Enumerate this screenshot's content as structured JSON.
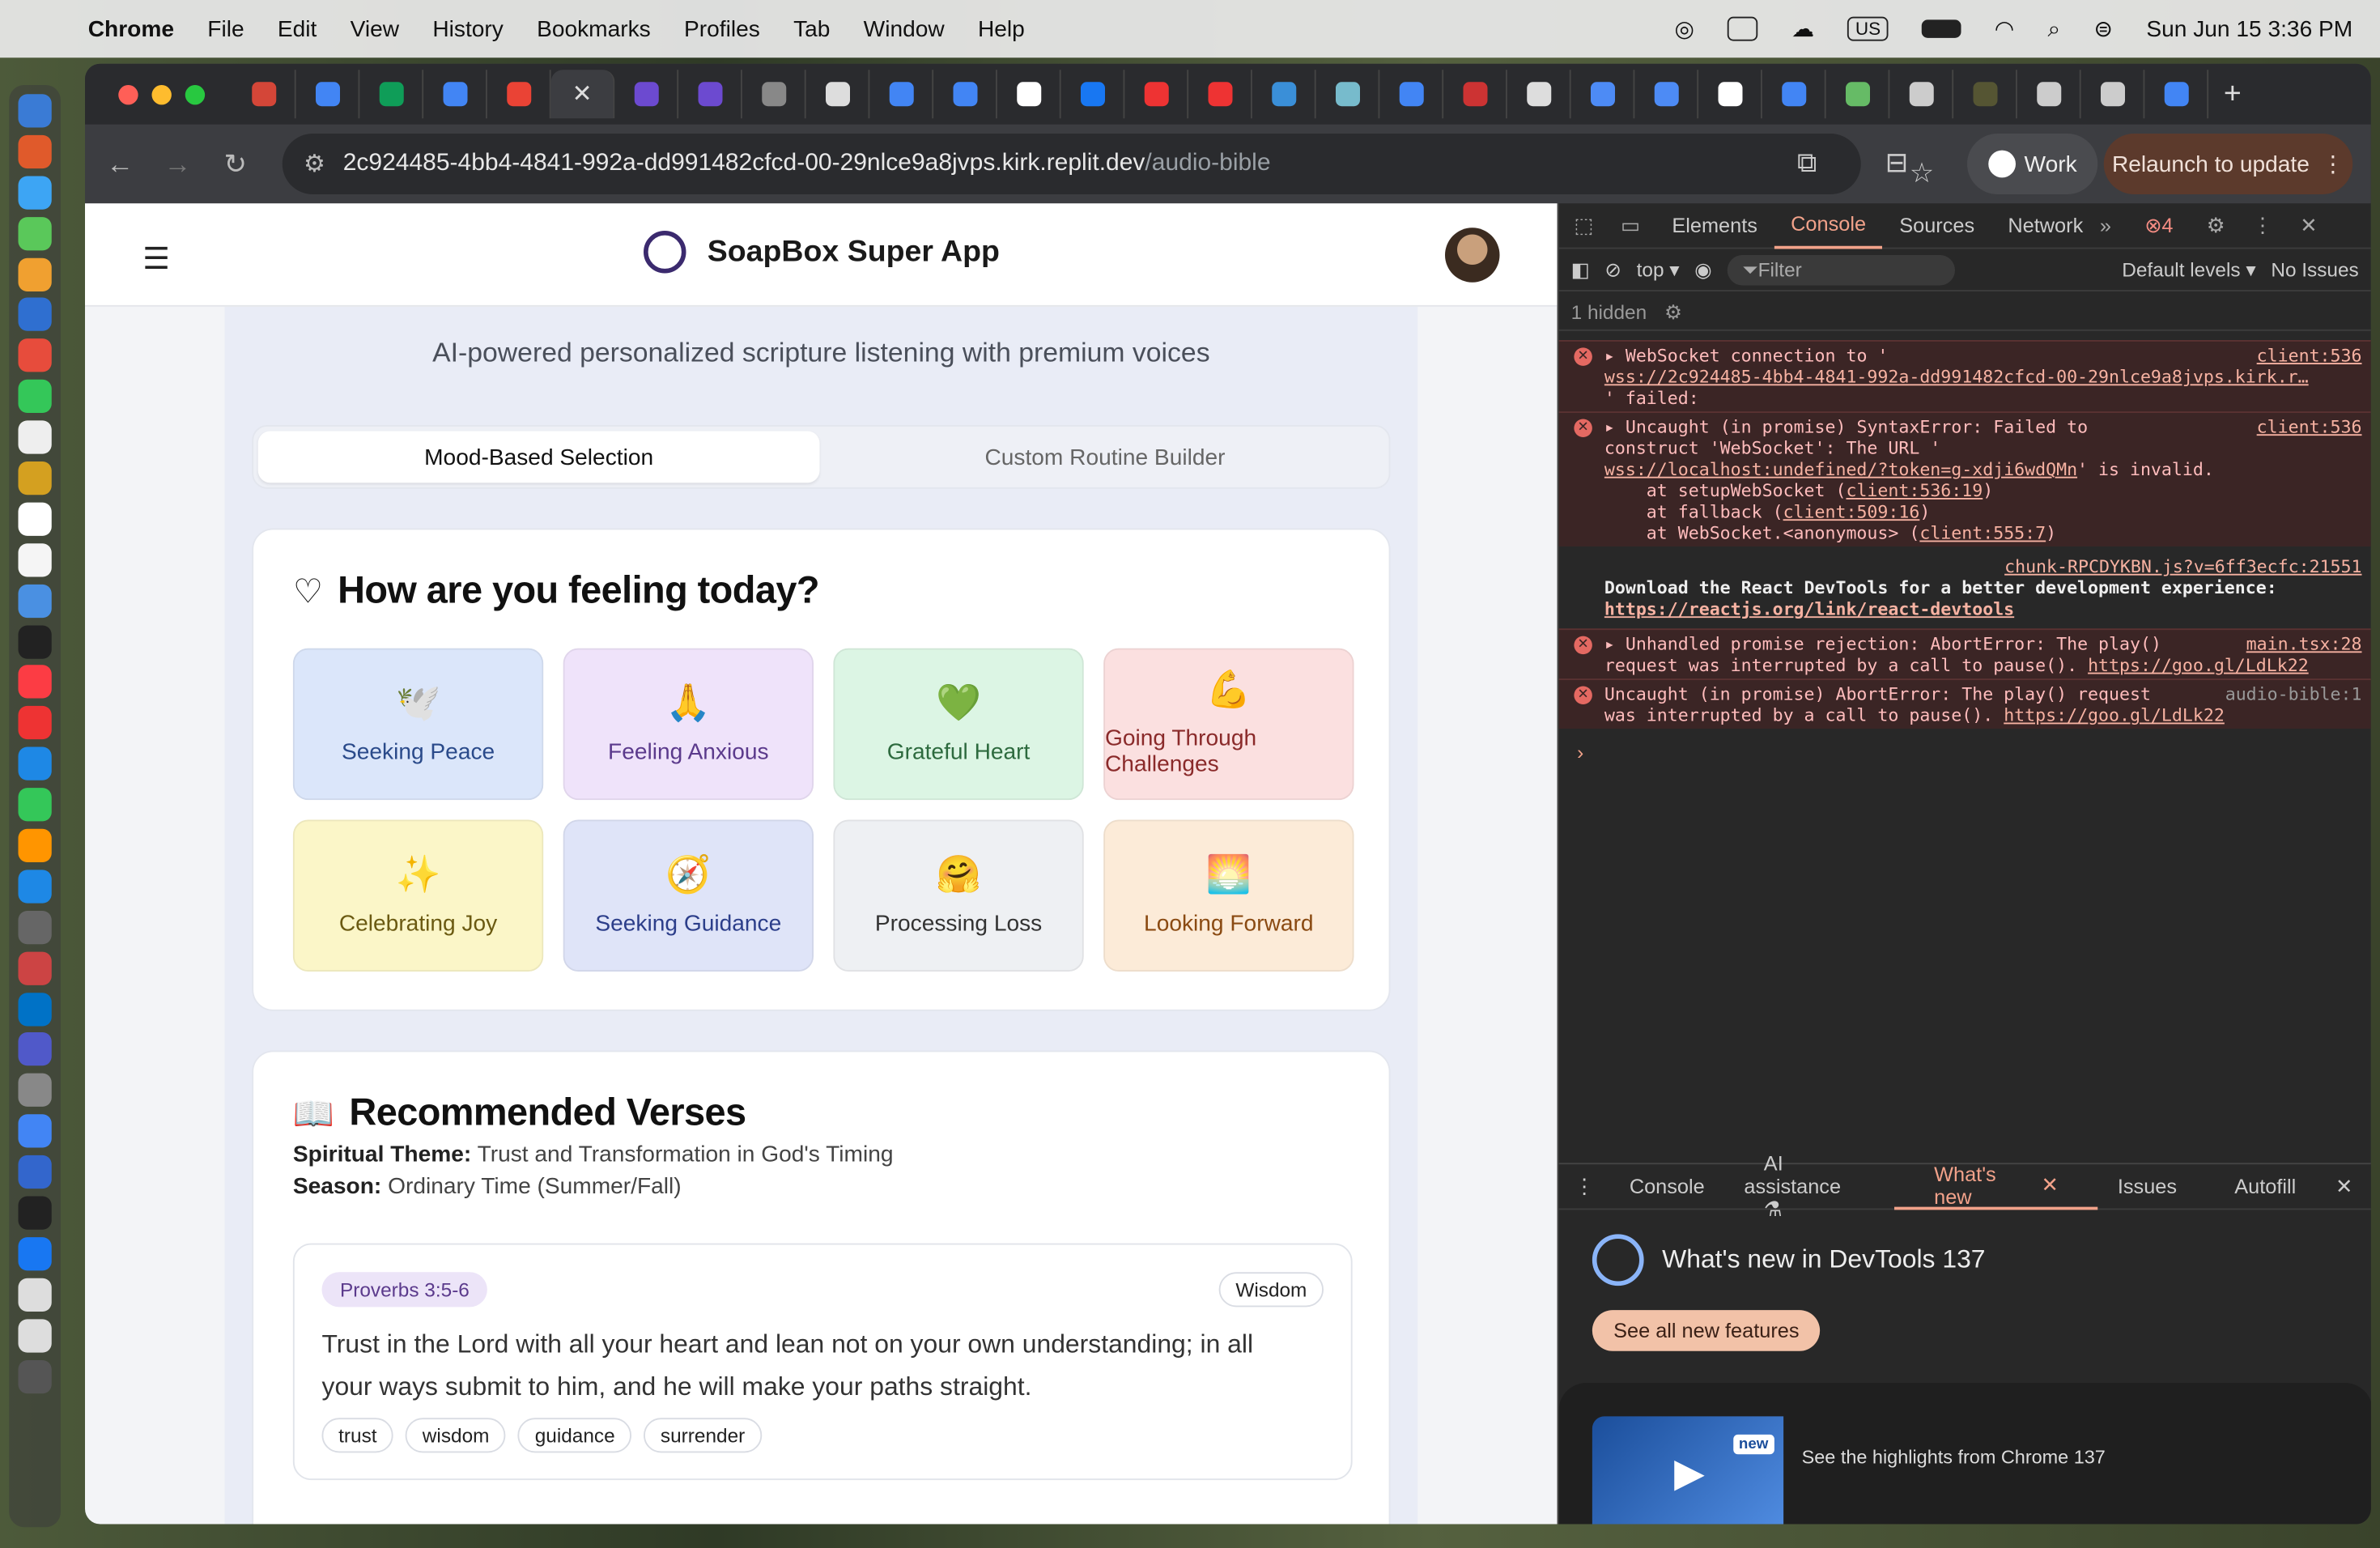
{
  "menubar": {
    "app": "Chrome",
    "items": [
      "File",
      "Edit",
      "View",
      "History",
      "Bookmarks",
      "Profiles",
      "Tab",
      "Window",
      "Help"
    ],
    "datetime": "Sun Jun 15  3:36 PM",
    "us_badge": "US"
  },
  "browser": {
    "url_host": "2c924485-4bb4-4841-992a-dd991482cfcd-00-29nlce9a8jvps.kirk.replit.dev",
    "url_path": "/audio-bible",
    "profile": "Work",
    "relaunch": "Relaunch to update",
    "tab_favicons": [
      "#d44638",
      "#4285f4",
      "#0f9d58",
      "#4285f4",
      "#ea4335",
      "close",
      "#6c4ad0",
      "#6c4ad0",
      "#888",
      "#ddd",
      "#4285f4",
      "#4285f4",
      "#fff",
      "#1877f2",
      "#e33",
      "#e33",
      "#3a8fd8",
      "#7bc",
      "#4285f4",
      "#c33",
      "#ddd",
      "#4d8bf5",
      "#4d8bf5",
      "#fff",
      "#4285f4",
      "#6b6",
      "#ccc",
      "#553",
      "#ccc",
      "#ccc",
      "#4285f4"
    ]
  },
  "app": {
    "title": "SoapBox Super App",
    "subtitle": "AI-powered personalized scripture listening with premium voices",
    "tabs": {
      "mood": "Mood-Based Selection",
      "routine": "Custom Routine Builder"
    },
    "mood_heading": "How are you feeling today?",
    "moods": [
      {
        "emoji": "🕊️",
        "label": "Seeking Peace",
        "bg": "#dbe6fa",
        "fg": "#2a4a8a"
      },
      {
        "emoji": "🙏",
        "label": "Feeling Anxious",
        "bg": "#efe3fa",
        "fg": "#5b3a8c"
      },
      {
        "emoji": "💚",
        "label": "Grateful Heart",
        "bg": "#dcf5e4",
        "fg": "#2d6a3e"
      },
      {
        "emoji": "💪",
        "label": "Going Through Challenges",
        "bg": "#fbe0e0",
        "fg": "#8a2a2a"
      },
      {
        "emoji": "✨",
        "label": "Celebrating Joy",
        "bg": "#fbf6c8",
        "fg": "#6b5a12"
      },
      {
        "emoji": "🧭",
        "label": "Seeking Guidance",
        "bg": "#dfe4f8",
        "fg": "#2c3e8a"
      },
      {
        "emoji": "🤗",
        "label": "Processing Loss",
        "bg": "#eef0f3",
        "fg": "#333"
      },
      {
        "emoji": "🌅",
        "label": "Looking Forward",
        "bg": "#fcebd8",
        "fg": "#8a4a12"
      }
    ],
    "verses_heading": "Recommended Verses",
    "theme_label": "Spiritual Theme:",
    "theme": "Trust and Transformation in God's Timing",
    "season_label": "Season:",
    "season": "Ordinary Time (Summer/Fall)",
    "verse": {
      "ref": "Proverbs 3:5-6",
      "category": "Wisdom",
      "text": "Trust in the Lord with all your heart and lean not on your own understanding; in all your ways submit to him, and he will make your paths straight.",
      "tags": [
        "trust",
        "wisdom",
        "guidance",
        "surrender"
      ]
    }
  },
  "devtools": {
    "tabs": [
      "Elements",
      "Console",
      "Sources",
      "Network"
    ],
    "error_count": "4",
    "context": "top",
    "filter_placeholder": "Filter",
    "levels": "Default levels",
    "issues": "No Issues",
    "hidden": "1 hidden",
    "logs": {
      "e1a": "WebSocket connection to '",
      "e1b": "wss://2c924485-4bb4-4841-992a-dd991482cfcd-00-29nlce9a8jvps.kirk.r…",
      "e1c": "' failed:",
      "e1src": "client:536",
      "e2a": "Uncaught (in promise) SyntaxError: Failed to",
      "e2b": "construct 'WebSocket': The URL '",
      "e2c": "wss://localhost:undefined/?token=g-xdji6wdQMn",
      "e2d": "' is invalid.",
      "e2e": "    at setupWebSocket (",
      "e2f": "client:536:19",
      "e2g": "    at fallback (",
      "e2h": "client:509:16",
      "e2i": "    at WebSocket.<anonymous> (",
      "e2j": "client:555:7",
      "e2src": "client:536",
      "i1src": "chunk-RPCDYKBN.js?v=6ff3ecfc:21551",
      "i1a": "Download the React DevTools for a better development experience:",
      "i1b": "https://reactjs.org/link/react-devtools",
      "e3a": "Unhandled promise rejection: AbortError: The play()",
      "e3b": "request was interrupted by a call to pause(). ",
      "e3link": "https://goo.gl/LdLk22",
      "e3src": "main.tsx:28",
      "e4a": "Uncaught (in promise) AbortError: The play() request",
      "e4b": "was interrupted by a call to pause(). ",
      "e4link": "https://goo.gl/LdLk22",
      "e4src": "audio-bible:1"
    },
    "drawer_tabs": [
      "Console",
      "AI assistance",
      "What's new",
      "Issues",
      "Autofill"
    ],
    "whats_new_title": "What's new in DevTools 137",
    "see_all": "See all new features",
    "new_badge": "new",
    "highlight": "See the highlights from Chrome 137"
  }
}
